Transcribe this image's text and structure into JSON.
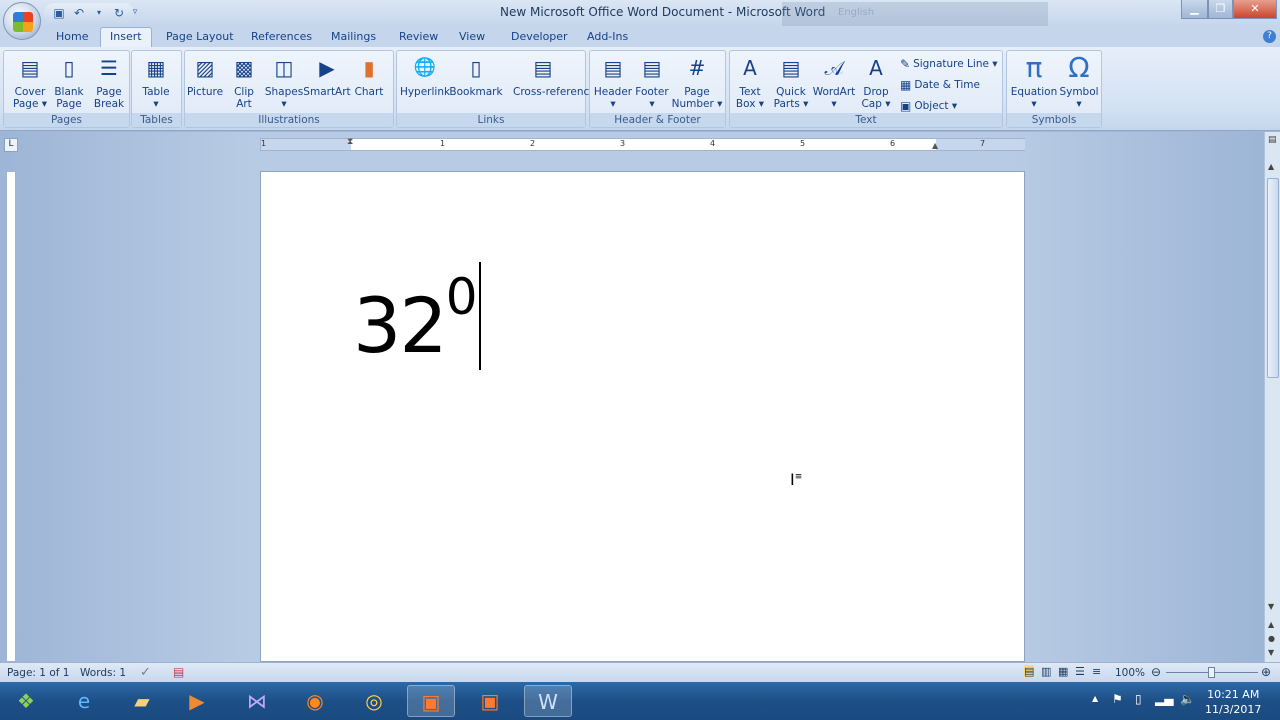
{
  "window": {
    "title": "New Microsoft Office Word Document - Microsoft Word",
    "language": "English"
  },
  "tabs": [
    "Home",
    "Insert",
    "Page Layout",
    "References",
    "Mailings",
    "Review",
    "View",
    "Developer",
    "Add-Ins"
  ],
  "active_tab": "Insert",
  "ribbon": {
    "groups": [
      {
        "label": "Pages",
        "items": [
          {
            "label": "Cover\nPage ▾",
            "icon": "cover-page-icon"
          },
          {
            "label": "Blank\nPage",
            "icon": "blank-page-icon"
          },
          {
            "label": "Page\nBreak",
            "icon": "page-break-icon"
          }
        ]
      },
      {
        "label": "Tables",
        "items": [
          {
            "label": "Table\n▾",
            "icon": "table-icon"
          }
        ]
      },
      {
        "label": "Illustrations",
        "items": [
          {
            "label": "Picture",
            "icon": "picture-icon"
          },
          {
            "label": "Clip\nArt",
            "icon": "clip-art-icon"
          },
          {
            "label": "Shapes\n▾",
            "icon": "shapes-icon"
          },
          {
            "label": "SmartArt",
            "icon": "smartart-icon"
          },
          {
            "label": "Chart",
            "icon": "chart-icon"
          }
        ]
      },
      {
        "label": "Links",
        "items": [
          {
            "label": "Hyperlink",
            "icon": "hyperlink-icon"
          },
          {
            "label": "Bookmark",
            "icon": "bookmark-icon"
          },
          {
            "label": "Cross-reference",
            "icon": "cross-reference-icon"
          }
        ]
      },
      {
        "label": "Header & Footer",
        "items": [
          {
            "label": "Header\n▾",
            "icon": "header-icon"
          },
          {
            "label": "Footer\n▾",
            "icon": "footer-icon"
          },
          {
            "label": "Page\nNumber ▾",
            "icon": "page-number-icon"
          }
        ]
      },
      {
        "label": "Text",
        "items": [
          {
            "label": "Text\nBox ▾",
            "icon": "text-box-icon"
          },
          {
            "label": "Quick\nParts ▾",
            "icon": "quick-parts-icon"
          },
          {
            "label": "WordArt\n▾",
            "icon": "wordart-icon"
          },
          {
            "label": "Drop\nCap ▾",
            "icon": "drop-cap-icon"
          }
        ],
        "small_items": [
          {
            "label": "Signature Line ▾",
            "icon": "signature-line-icon"
          },
          {
            "label": "Date & Time",
            "icon": "date-time-icon"
          },
          {
            "label": "Object ▾",
            "icon": "object-icon"
          }
        ]
      },
      {
        "label": "Symbols",
        "items": [
          {
            "label": "Equation\n▾",
            "icon": "equation-icon"
          },
          {
            "label": "Symbol\n▾",
            "icon": "symbol-icon"
          }
        ]
      }
    ]
  },
  "ruler": {
    "numbers": [
      "1",
      "1",
      "2",
      "3",
      "4",
      "5",
      "6",
      "7"
    ]
  },
  "document": {
    "text": "32",
    "superscript": "0"
  },
  "status": {
    "page": "Page: 1 of 1",
    "words": "Words: 1",
    "zoom": "100%"
  },
  "taskbar": {
    "time": "10:21 AM",
    "date": "11/3/2017"
  }
}
